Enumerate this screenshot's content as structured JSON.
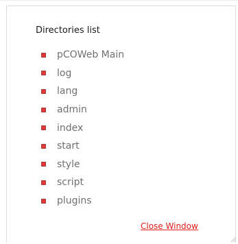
{
  "panel": {
    "title": "Directories list",
    "bullet_color": "#e03838",
    "directories": [
      "pCOWeb Main",
      "log",
      "lang",
      "admin",
      "index",
      "start",
      "style",
      "script",
      "plugins"
    ],
    "close_label": "Close Window",
    "close_color": "#e21b1b"
  },
  "icons": {
    "bullet": "square-bullet-icon",
    "resize": "resize-grip-icon"
  }
}
